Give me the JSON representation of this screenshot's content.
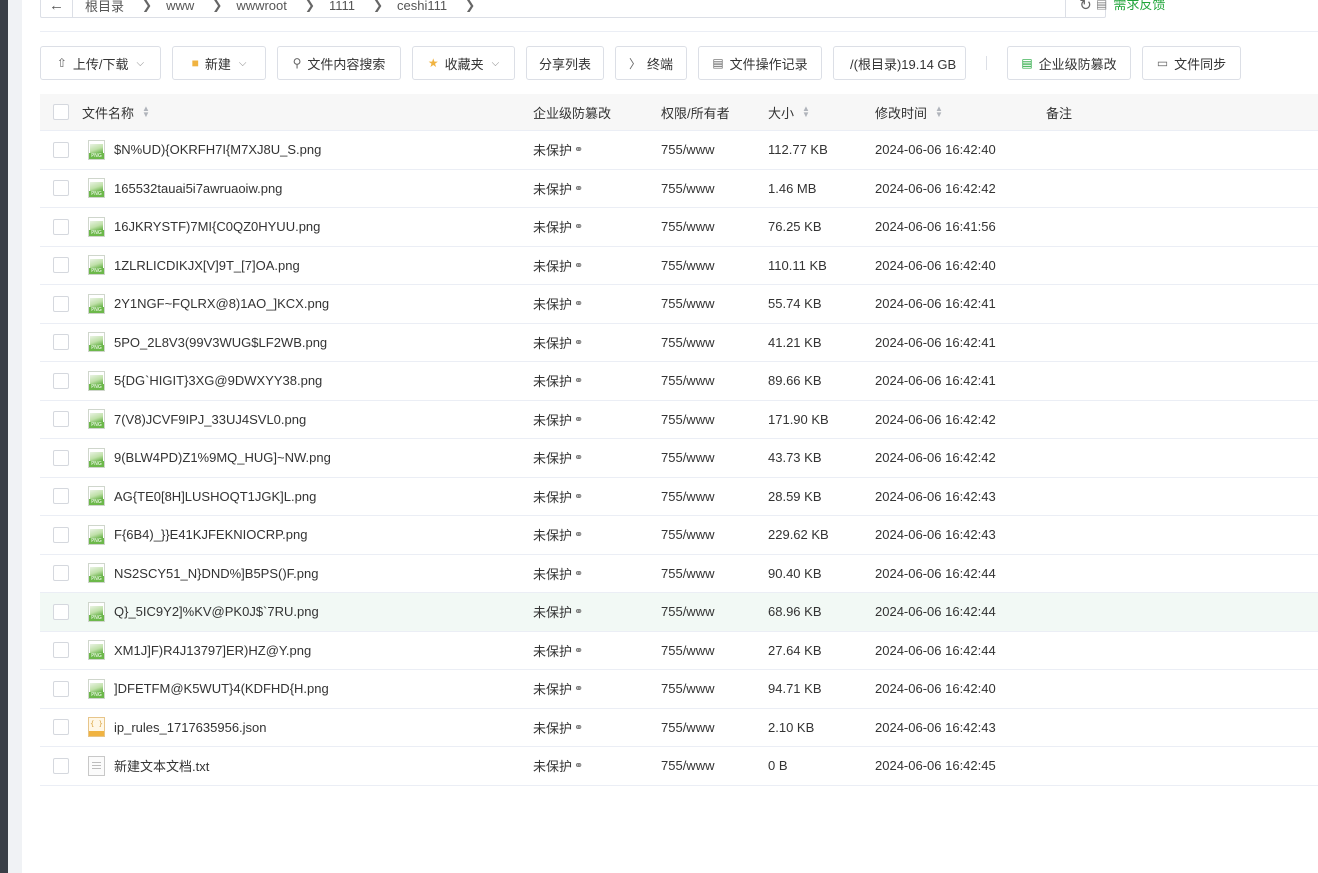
{
  "breadcrumb": [
    "根目录",
    "www",
    "wwwroot",
    "1111",
    "ceshi111"
  ],
  "feedback": "需求反馈",
  "toolbar": {
    "upload": "上传/下载",
    "new": "新建",
    "search": "文件内容搜索",
    "favorites": "收藏夹",
    "share": "分享列表",
    "terminal": "终端",
    "oplog": "文件操作记录",
    "disk": "/(根目录)19.14 GB",
    "tamper": "企业级防篡改",
    "sync": "文件同步"
  },
  "table": {
    "headers": {
      "name": "文件名称",
      "protect": "企业级防篡改",
      "perm": "权限/所有者",
      "size": "大小",
      "mtime": "修改时间",
      "note": "备注"
    },
    "rows": [
      {
        "icon": "png",
        "name": "$N%UD){OKRFH7I{M7XJ8U_S.png",
        "protect": "未保护",
        "perm": "755/www",
        "size": "112.77 KB",
        "mtime": "2024-06-06 16:42:40"
      },
      {
        "icon": "png",
        "name": "165532tauai5i7awruaoiw.png",
        "protect": "未保护",
        "perm": "755/www",
        "size": "1.46 MB",
        "mtime": "2024-06-06 16:42:42"
      },
      {
        "icon": "png",
        "name": "16JKRYSTF)7MI{C0QZ0HYUU.png",
        "protect": "未保护",
        "perm": "755/www",
        "size": "76.25 KB",
        "mtime": "2024-06-06 16:41:56"
      },
      {
        "icon": "png",
        "name": "1ZLRLICDIKJX[V]9T_[7]OA.png",
        "protect": "未保护",
        "perm": "755/www",
        "size": "110.11 KB",
        "mtime": "2024-06-06 16:42:40"
      },
      {
        "icon": "png",
        "name": "2Y1NGF~FQLRX@8)1AO_]KCX.png",
        "protect": "未保护",
        "perm": "755/www",
        "size": "55.74 KB",
        "mtime": "2024-06-06 16:42:41"
      },
      {
        "icon": "png",
        "name": "5PO_2L8V3(99V3WUG$LF2WB.png",
        "protect": "未保护",
        "perm": "755/www",
        "size": "41.21 KB",
        "mtime": "2024-06-06 16:42:41"
      },
      {
        "icon": "png",
        "name": "5{DG`HIGIT}3XG@9DWXYY38.png",
        "protect": "未保护",
        "perm": "755/www",
        "size": "89.66 KB",
        "mtime": "2024-06-06 16:42:41"
      },
      {
        "icon": "png",
        "name": "7(V8)JCVF9IPJ_33UJ4SVL0.png",
        "protect": "未保护",
        "perm": "755/www",
        "size": "171.90 KB",
        "mtime": "2024-06-06 16:42:42"
      },
      {
        "icon": "png",
        "name": "9(BLW4PD)Z1%9MQ_HUG]~NW.png",
        "protect": "未保护",
        "perm": "755/www",
        "size": "43.73 KB",
        "mtime": "2024-06-06 16:42:42"
      },
      {
        "icon": "png",
        "name": "AG{TE0[8H]LUSHOQT1JGK]L.png",
        "protect": "未保护",
        "perm": "755/www",
        "size": "28.59 KB",
        "mtime": "2024-06-06 16:42:43"
      },
      {
        "icon": "png",
        "name": "F{6B4)_}}E41KJFEKNIOCRP.png",
        "protect": "未保护",
        "perm": "755/www",
        "size": "229.62 KB",
        "mtime": "2024-06-06 16:42:43"
      },
      {
        "icon": "png",
        "name": "NS2SCY51_N}DND%]B5PS()F.png",
        "protect": "未保护",
        "perm": "755/www",
        "size": "90.40 KB",
        "mtime": "2024-06-06 16:42:44"
      },
      {
        "icon": "png",
        "name": "Q}_5IC9Y2]%KV@PK0J$`7RU.png",
        "protect": "未保护",
        "perm": "755/www",
        "size": "68.96 KB",
        "mtime": "2024-06-06 16:42:44",
        "highlight": true
      },
      {
        "icon": "png",
        "name": "XM1J]F)R4J13797]ER)HZ@Y.png",
        "protect": "未保护",
        "perm": "755/www",
        "size": "27.64 KB",
        "mtime": "2024-06-06 16:42:44"
      },
      {
        "icon": "png",
        "name": "]DFETFM@K5WUT}4(KDFHD{H.png",
        "protect": "未保护",
        "perm": "755/www",
        "size": "94.71 KB",
        "mtime": "2024-06-06 16:42:40"
      },
      {
        "icon": "json",
        "name": "ip_rules_1717635956.json",
        "protect": "未保护",
        "perm": "755/www",
        "size": "2.10 KB",
        "mtime": "2024-06-06 16:42:43"
      },
      {
        "icon": "txt",
        "name": "新建文本文档.txt",
        "protect": "未保护",
        "perm": "755/www",
        "size": "0 B",
        "mtime": "2024-06-06 16:42:45"
      }
    ]
  }
}
